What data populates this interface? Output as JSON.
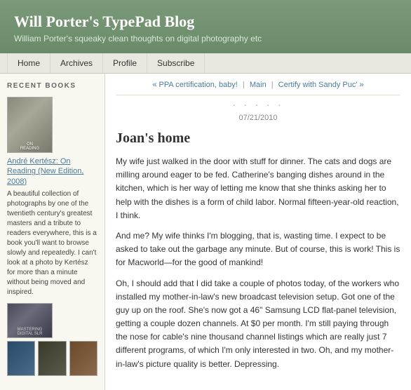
{
  "header": {
    "title": "Will Porter's TypePad Blog",
    "subtitle": "William Porter's squeaky clean thoughts on digital photography etc"
  },
  "nav": {
    "items": [
      {
        "label": "Home",
        "id": "home"
      },
      {
        "label": "Archives",
        "id": "archives"
      },
      {
        "label": "Profile",
        "id": "profile"
      },
      {
        "label": "Subscribe",
        "id": "subscribe"
      }
    ]
  },
  "sidebar": {
    "title": "Recent Books",
    "book1": {
      "title": "André Kertész: On Reading (New Edition, 2008)",
      "description": "A beautiful collection of photographs by one of the twentieth century's greatest masters and a tribute to readers everywhere, this is a book you'll want to browse slowly and repeatedly. I can't look at a photo by Kertész for more than a minute without being moved and inspired."
    },
    "book2": {
      "title": "Mastering Digital SLR Photography"
    }
  },
  "post": {
    "nav": {
      "prev": "« PPA certification, baby!",
      "mid": "Main",
      "next": "Certify with Sandy Puc' »"
    },
    "dots": "· · · · ·",
    "date": "07/21/2010",
    "title": "Joan's home",
    "paragraphs": [
      "My wife just walked in the door with stuff for dinner. The cats and dogs are milling around eager to be fed. Catherine's banging dishes around in the kitchen, which is her way of letting me know that she thinks asking her to help with the dishes is a form of child labor. Normal fifteen-year-old reaction, I think.",
      "And me? My wife thinks I'm blogging, that is, wasting time. I expect to be asked to take out the garbage any minute. But of course, this is work! This is for Macworld—for the good of mankind!",
      "Oh, I should add that I did take a couple of photos today, of the workers who installed my mother-in-law's new broadcast television setup. Got one of the guy up on the roof. She's now got a 46\" Samsung LCD flat-panel television, getting a couple dozen channels. At $0 per month. I'm still paying through the nose for cable's nine thousand channel listings which are really just 7 different programs, of which I'm only interested in two. Oh, and my mother-in-law's picture quality is better. Depressing."
    ]
  }
}
